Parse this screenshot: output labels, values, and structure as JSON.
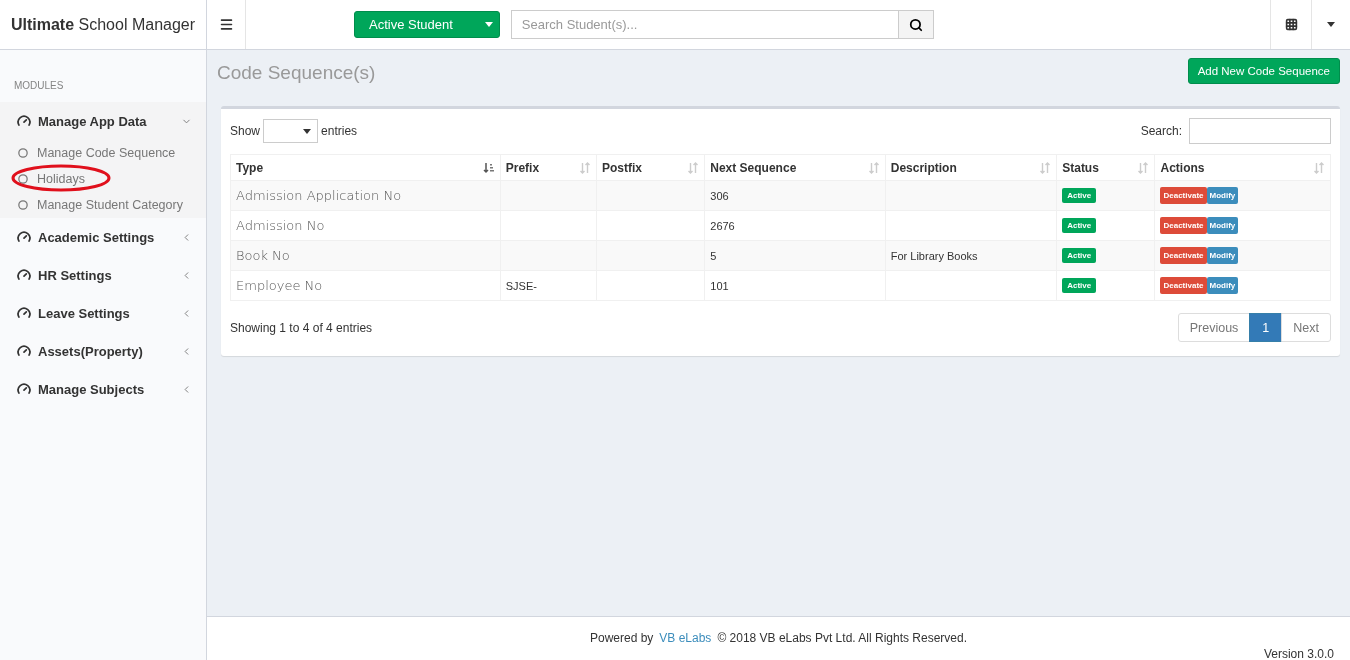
{
  "brand": {
    "bold": "Ultimate",
    "rest": "School Manager"
  },
  "topbar": {
    "student_button": "Active Student",
    "search": {
      "placeholder": "Search Student(s)..."
    }
  },
  "sidebar": {
    "header": "MODULES",
    "items": [
      {
        "label": "Manage App Data",
        "expanded": true,
        "children": [
          {
            "label": "Manage Code Sequence",
            "circled": false
          },
          {
            "label": "Holidays",
            "circled": true
          },
          {
            "label": "Manage Student Category",
            "circled": false
          }
        ]
      },
      {
        "label": "Academic Settings",
        "expanded": false
      },
      {
        "label": "HR Settings",
        "expanded": false
      },
      {
        "label": "Leave Settings",
        "expanded": false
      },
      {
        "label": "Assets(Property)",
        "expanded": false
      },
      {
        "label": "Manage Subjects",
        "expanded": false
      }
    ]
  },
  "page": {
    "title": "Code Sequence(s)",
    "add_button": "Add New Code Sequence"
  },
  "table_controls": {
    "show_label": "Show",
    "entries_label": "entries",
    "search_label": "Search:"
  },
  "table": {
    "columns": [
      {
        "label": "Type",
        "sorted": true
      },
      {
        "label": "Prefix",
        "sorted": false
      },
      {
        "label": "Postfix",
        "sorted": false
      },
      {
        "label": "Next Sequence",
        "sorted": false
      },
      {
        "label": "Description",
        "sorted": false
      },
      {
        "label": "Status",
        "sorted": false
      },
      {
        "label": "Actions",
        "sorted": false
      }
    ],
    "rows": [
      {
        "type": "Admission Application No",
        "prefix": "",
        "postfix": "",
        "next": "306",
        "description": "",
        "status": "Active",
        "actions": [
          "Deactivate",
          "Modify"
        ]
      },
      {
        "type": "Admission No",
        "prefix": "",
        "postfix": "",
        "next": "2676",
        "description": "",
        "status": "Active",
        "actions": [
          "Deactivate",
          "Modify"
        ]
      },
      {
        "type": "Book No",
        "prefix": "",
        "postfix": "",
        "next": "5",
        "description": "For Library Books",
        "status": "Active",
        "actions": [
          "Deactivate",
          "Modify"
        ]
      },
      {
        "type": "Employee No",
        "prefix": "SJSE-",
        "postfix": "",
        "next": "101",
        "description": "",
        "status": "Active",
        "actions": [
          "Deactivate",
          "Modify"
        ]
      }
    ]
  },
  "info": "Showing 1 to 4 of 4 entries",
  "pagination": [
    {
      "label": "Previous",
      "selected": false
    },
    {
      "label": "1",
      "selected": true
    },
    {
      "label": "Next",
      "selected": false
    }
  ],
  "footer": {
    "powered": "Powered by",
    "link": "VB eLabs",
    "copyright": "© 2018 VB eLabs Pvt Ltd. All Rights Reserved.",
    "version": "Version 3.0.0"
  }
}
